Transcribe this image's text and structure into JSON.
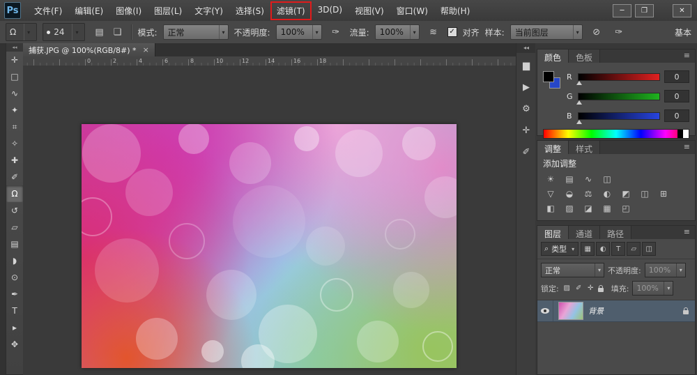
{
  "ui": {
    "dropdown_arrow": "▾",
    "check": "✓"
  },
  "menu": {
    "logo": "Ps",
    "items": [
      {
        "id": "file",
        "label": "文件(F)"
      },
      {
        "id": "edit",
        "label": "编辑(E)"
      },
      {
        "id": "image",
        "label": "图像(I)"
      },
      {
        "id": "layer",
        "label": "图层(L)"
      },
      {
        "id": "type",
        "label": "文字(Y)"
      },
      {
        "id": "select",
        "label": "选择(S)"
      },
      {
        "id": "filter",
        "label": "滤镜(T)",
        "highlighted": true
      },
      {
        "id": "3d",
        "label": "3D(D)"
      },
      {
        "id": "view",
        "label": "视图(V)"
      },
      {
        "id": "window",
        "label": "窗口(W)"
      },
      {
        "id": "help",
        "label": "帮助(H)"
      }
    ]
  },
  "window_controls": [
    {
      "id": "minimize",
      "glyph": "─"
    },
    {
      "id": "maximize",
      "glyph": "❐"
    },
    {
      "id": "close",
      "glyph": "✕"
    }
  ],
  "options_bar": {
    "tool_preset_glyph": "Ω",
    "brush_size": "24",
    "toggle_icons": [
      {
        "id": "toggle-brush-panel",
        "glyph": "▤"
      },
      {
        "id": "toggle-clone-source-panel",
        "glyph": "❏"
      }
    ],
    "mode_label": "模式:",
    "mode_value": "正常",
    "opacity_label": "不透明度:",
    "opacity_value": "100%",
    "pressure_opacity_glyph": "✑",
    "flow_label": "流量:",
    "flow_value": "100%",
    "airbrush_glyph": "≋",
    "align_label": "对齐",
    "sample_label": "样本:",
    "sample_value": "当前图层",
    "ignore_adjustment_glyph": "⊘",
    "pressure_size_glyph": "✑",
    "workspace_label": "基本"
  },
  "document_tab": {
    "title": "捕获.JPG @ 100%(RGB/8#) *",
    "close_glyph": "×"
  },
  "ruler_ticks": [
    "0",
    "2",
    "4",
    "6",
    "8",
    "10",
    "12",
    "14",
    "16",
    "18"
  ],
  "toolbar": {
    "collapse_glyph": "◂◂",
    "tools": [
      {
        "id": "move",
        "glyph": "✛"
      },
      {
        "id": "rectangular-marquee",
        "glyph": "□"
      },
      {
        "id": "lasso",
        "glyph": "∿"
      },
      {
        "id": "quick-selection",
        "glyph": "✦"
      },
      {
        "id": "crop",
        "glyph": "⌗"
      },
      {
        "id": "eyedropper",
        "glyph": "✧"
      },
      {
        "id": "spot-healing-brush",
        "glyph": "✚"
      },
      {
        "id": "brush",
        "glyph": "✐"
      },
      {
        "id": "clone-stamp",
        "glyph": "Ω",
        "active": true
      },
      {
        "id": "history-brush",
        "glyph": "↺"
      },
      {
        "id": "eraser",
        "glyph": "▱"
      },
      {
        "id": "gradient",
        "glyph": "▤"
      },
      {
        "id": "blur",
        "glyph": "◗"
      },
      {
        "id": "dodge",
        "glyph": "⊙"
      },
      {
        "id": "pen",
        "glyph": "✒"
      },
      {
        "id": "type",
        "glyph": "T"
      },
      {
        "id": "path-selection",
        "glyph": "▸"
      },
      {
        "id": "hand",
        "glyph": "✥"
      }
    ]
  },
  "panel_strip": {
    "collapse_glyph": "◂◂",
    "icons": [
      {
        "id": "histogram",
        "glyph": "▆"
      },
      {
        "id": "actions",
        "glyph": "▶"
      },
      {
        "id": "properties",
        "glyph": "⚙"
      },
      {
        "id": "info",
        "glyph": "✛"
      },
      {
        "id": "brush-settings",
        "glyph": "✐"
      }
    ]
  },
  "color_panel": {
    "tabs": [
      {
        "id": "color",
        "label": "颜色",
        "active": true
      },
      {
        "id": "swatches",
        "label": "色板"
      }
    ],
    "menu_glyph": "≡",
    "channels": [
      {
        "label": "R",
        "value": "0",
        "color": "#e02020"
      },
      {
        "label": "G",
        "value": "0",
        "color": "#1fb31f"
      },
      {
        "label": "B",
        "value": "0",
        "color": "#2744e0"
      }
    ]
  },
  "adjustments_panel": {
    "tabs": [
      {
        "id": "adjustments",
        "label": "调整",
        "active": true
      },
      {
        "id": "styles",
        "label": "样式"
      }
    ],
    "menu_glyph": "≡",
    "title": "添加调整",
    "icon_rows": [
      [
        {
          "id": "brightness-contrast",
          "glyph": "☀"
        },
        {
          "id": "levels",
          "glyph": "▤"
        },
        {
          "id": "curves",
          "glyph": "∿"
        },
        {
          "id": "exposure",
          "glyph": "◫"
        }
      ],
      [
        {
          "id": "vibrance",
          "glyph": "▽"
        },
        {
          "id": "hue-saturation",
          "glyph": "◒"
        },
        {
          "id": "color-balance",
          "glyph": "⚖"
        },
        {
          "id": "black-white",
          "glyph": "◐"
        },
        {
          "id": "photo-filter",
          "glyph": "◩"
        },
        {
          "id": "channel-mixer",
          "glyph": "◫"
        },
        {
          "id": "color-lookup",
          "glyph": "⊞"
        }
      ],
      [
        {
          "id": "invert",
          "glyph": "◧"
        },
        {
          "id": "posterize",
          "glyph": "▨"
        },
        {
          "id": "threshold",
          "glyph": "◪"
        },
        {
          "id": "gradient-map",
          "glyph": "▦"
        },
        {
          "id": "selective-color",
          "glyph": "◰"
        }
      ]
    ]
  },
  "layers_panel": {
    "tabs": [
      {
        "id": "layers",
        "label": "图层",
        "active": true
      },
      {
        "id": "channels",
        "label": "通道"
      },
      {
        "id": "paths",
        "label": "路径"
      }
    ],
    "menu_glyph": "≡",
    "filter_glyph": "⌕",
    "filter_label": "类型",
    "filter_icons": [
      {
        "id": "filter-pixel-layers",
        "glyph": "▦"
      },
      {
        "id": "filter-adjustment-layers",
        "glyph": "◐"
      },
      {
        "id": "filter-type-layers",
        "glyph": "T"
      },
      {
        "id": "filter-shape-layers",
        "glyph": "▱"
      },
      {
        "id": "filter-smart-objects",
        "glyph": "◫"
      }
    ],
    "blend_mode": "正常",
    "opacity_label": "不透明度:",
    "opacity_value": "100%",
    "lock_label": "锁定:",
    "lock_icons": [
      {
        "id": "lock-transparency",
        "glyph": "▨"
      },
      {
        "id": "lock-pixels",
        "glyph": "✐"
      },
      {
        "id": "lock-position",
        "glyph": "✛"
      },
      {
        "id": "lock-all",
        "glyph": "lock"
      }
    ],
    "fill_label": "填充:",
    "fill_value": "100%",
    "layers": [
      {
        "name": "背景",
        "visible": true,
        "locked": true,
        "selected": true
      }
    ]
  }
}
